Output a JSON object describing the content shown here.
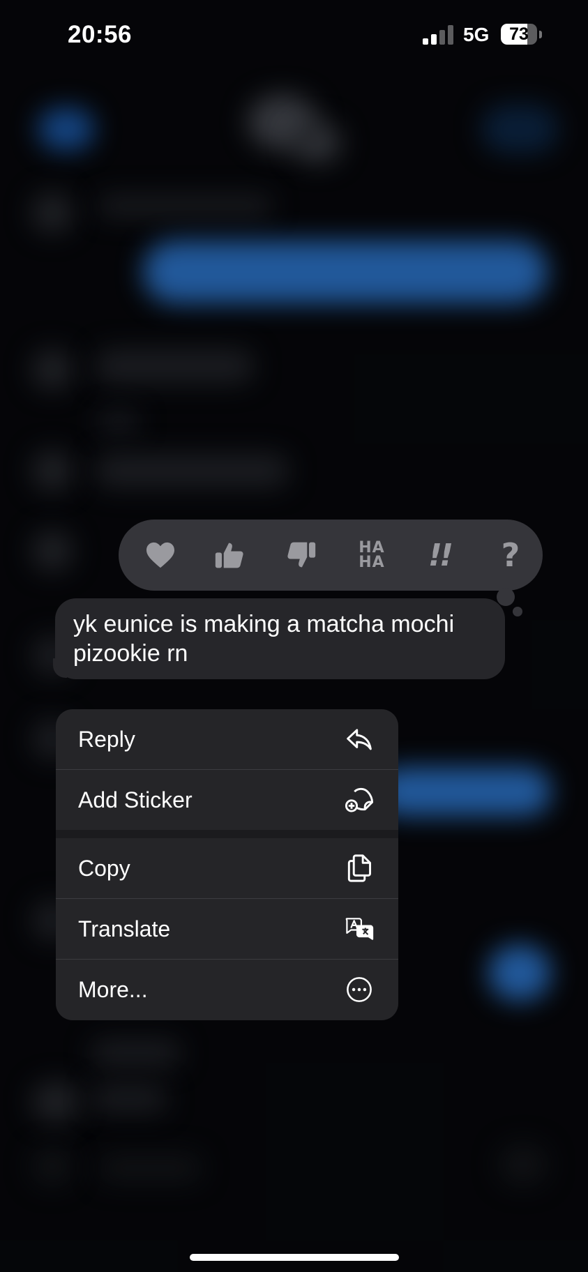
{
  "status_bar": {
    "time": "20:56",
    "network": "5G",
    "battery_level": "73"
  },
  "tapbacks": [
    {
      "name": "heart",
      "label": ""
    },
    {
      "name": "thumbs-up",
      "label": ""
    },
    {
      "name": "thumbs-down",
      "label": ""
    },
    {
      "name": "haha",
      "label": "HA HA"
    },
    {
      "name": "exclamation",
      "label": "!!"
    },
    {
      "name": "question",
      "label": "?"
    }
  ],
  "message": {
    "text": "yk eunice is making a matcha mochi pizookie rn"
  },
  "context_menu": {
    "items": [
      {
        "label": "Reply",
        "icon": "reply-arrow-icon"
      },
      {
        "label": "Add Sticker",
        "icon": "add-sticker-icon"
      },
      {
        "label": "Copy",
        "icon": "copy-icon"
      },
      {
        "label": "Translate",
        "icon": "translate-icon"
      },
      {
        "label": "More...",
        "icon": "more-ellipsis-icon"
      }
    ]
  },
  "colors": {
    "background": "#07080c",
    "tapback_bar": "#35353a",
    "bubble": "#26262a",
    "menu": "#252528",
    "accent_blue": "#2f7bd6"
  }
}
